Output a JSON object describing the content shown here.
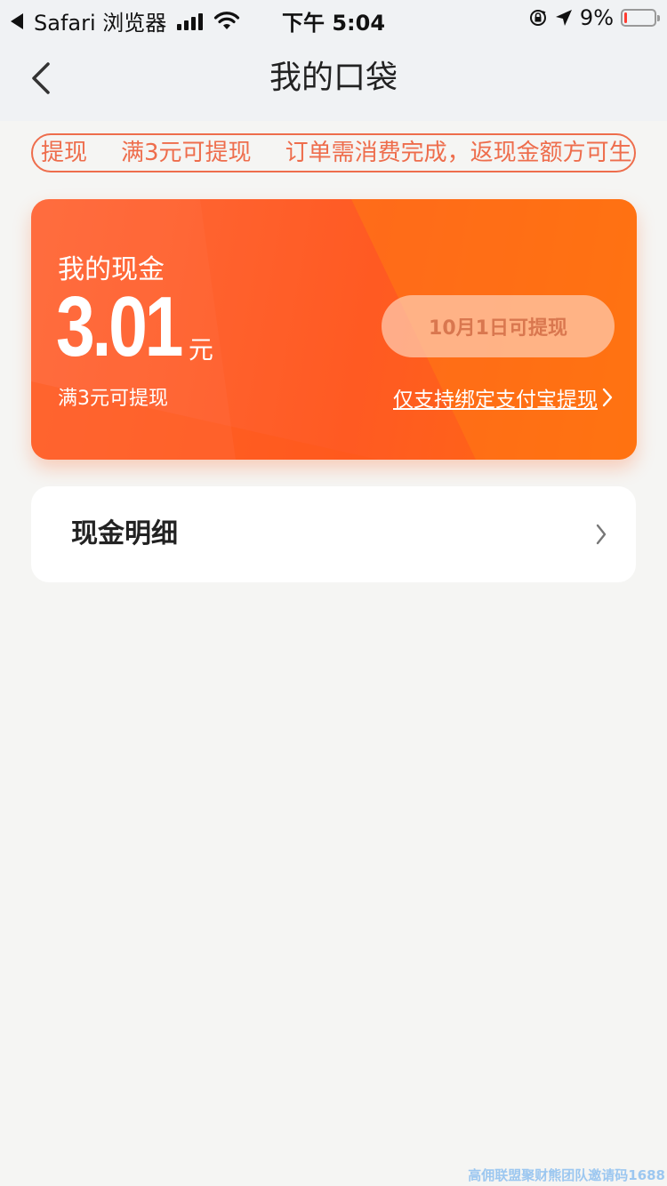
{
  "status_bar": {
    "carrier": "Safari 浏览器",
    "time": "下午 5:04",
    "battery_text": "9%",
    "battery_level": 0.09
  },
  "nav": {
    "title": "我的口袋"
  },
  "notice": {
    "items": [
      "提现",
      "满3元可提现",
      "订单需消费完成，返现金额方可生"
    ]
  },
  "cash_card": {
    "label": "我的现金",
    "amount": "3.01",
    "unit": "元",
    "threshold_text": "满3元可提现",
    "withdraw_button": "10月1日可提现",
    "alipay_link": "仅支持绑定支付宝提现"
  },
  "detail": {
    "label": "现金明细"
  },
  "watermark": "高佣联盟聚财熊团队邀请码1688",
  "colors": {
    "accent": "#ff5a22",
    "notice": "#ee6d4c"
  }
}
